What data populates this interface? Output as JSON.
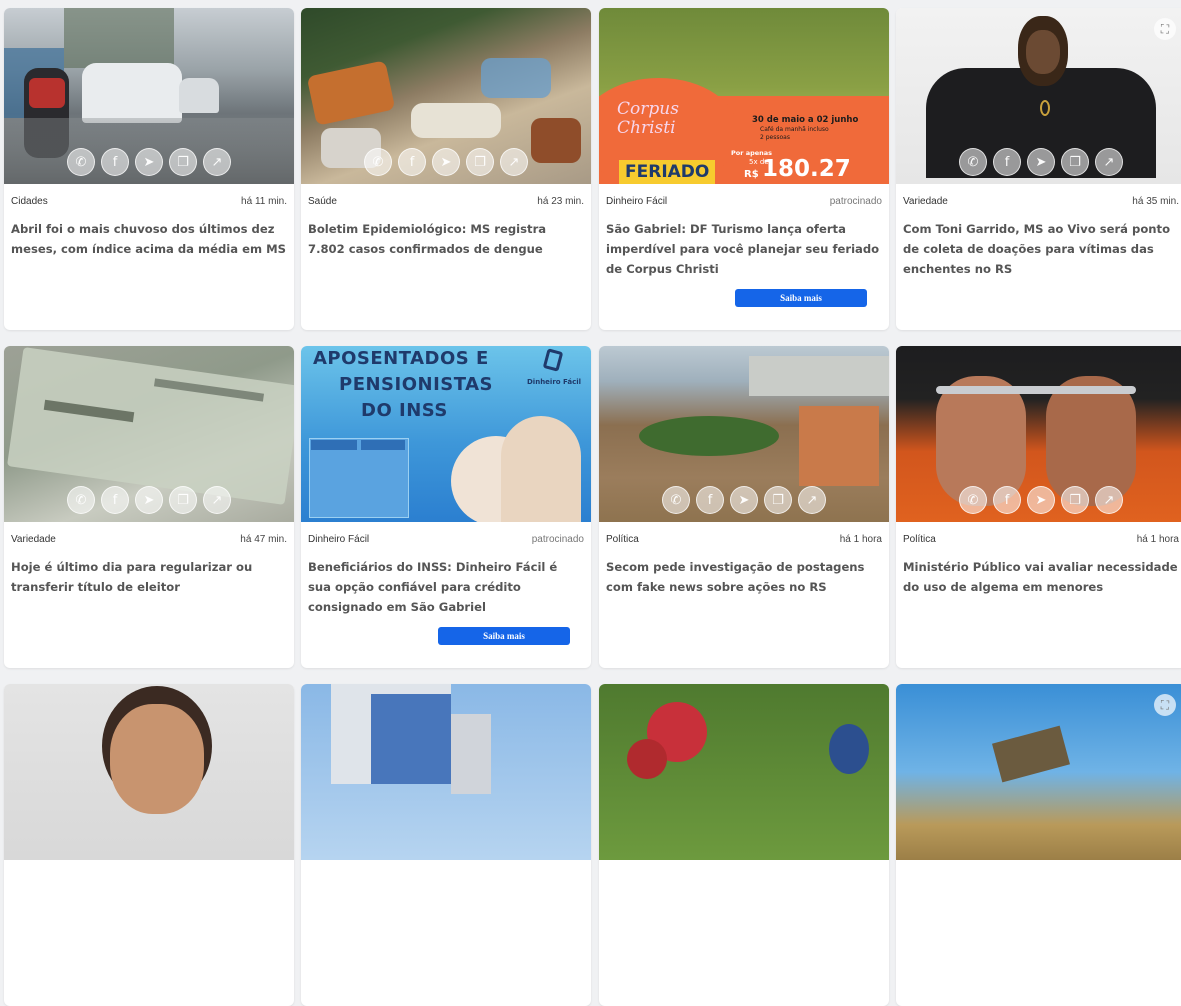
{
  "cards": [
    {
      "category": "Cidades",
      "time": "há 11 min.",
      "title": "Abril foi o mais chuvoso dos últimos dez meses, com índice acima da média em MS"
    },
    {
      "category": "Saúde",
      "time": "há 23 min.",
      "title": "Boletim Epidemiológico: MS registra 7.802 casos confirmados de dengue"
    },
    {
      "category": "Dinheiro Fácil",
      "time": "patrocinado",
      "title": "São Gabriel: DF Turismo lança oferta imperdível para você planejar seu feriado de Corpus Christi",
      "cta": "Saiba mais",
      "ad": {
        "script": "Corpus Christi",
        "banner": "FERIADO",
        "dates": "30 de maio a 02 junho",
        "line1": "Café da manhã incluso",
        "line2": "2 pessoas",
        "por": "Por apenas",
        "parcel": "5x de",
        "currency": "R$",
        "price": "180.27"
      }
    },
    {
      "category": "Variedade",
      "time": "há 35 min.",
      "title": "Com Toni Garrido, MS ao Vivo será ponto de coleta de doações para vítimas das enchentes no RS"
    },
    {
      "category": "Variedade",
      "time": "há 47 min.",
      "title": "Hoje é último dia para regularizar ou transferir título de eleitor"
    },
    {
      "category": "Dinheiro Fácil",
      "time": "patrocinado",
      "title": "Beneficiários do INSS: Dinheiro Fácil é sua opção confiável para crédito consignado em São Gabriel",
      "cta": "Saiba mais",
      "ad": {
        "headline1": "APOSENTADOS E",
        "headline2": "PENSIONISTAS",
        "headline3": "DO INSS",
        "brand": "Dinheiro Fácil"
      }
    },
    {
      "category": "Política",
      "time": "há 1 hora",
      "title": "Secom pede investigação de postagens com fake news sobre ações no RS"
    },
    {
      "category": "Política",
      "time": "há 1 hora",
      "title": "Ministério Público vai avaliar necessidade do uso de algema em menores"
    },
    {
      "category": "",
      "time": "",
      "title": ""
    },
    {
      "category": "",
      "time": "",
      "title": ""
    },
    {
      "category": "",
      "time": "",
      "title": ""
    },
    {
      "category": "",
      "time": "",
      "title": ""
    }
  ],
  "share_icons": [
    "whatsapp-icon",
    "facebook-icon",
    "telegram-icon",
    "copy-icon",
    "external-link-icon"
  ],
  "colors": {
    "cta": "#1565e8",
    "card_bg": "#ffffff",
    "page_bg": "#f0f1f3"
  }
}
